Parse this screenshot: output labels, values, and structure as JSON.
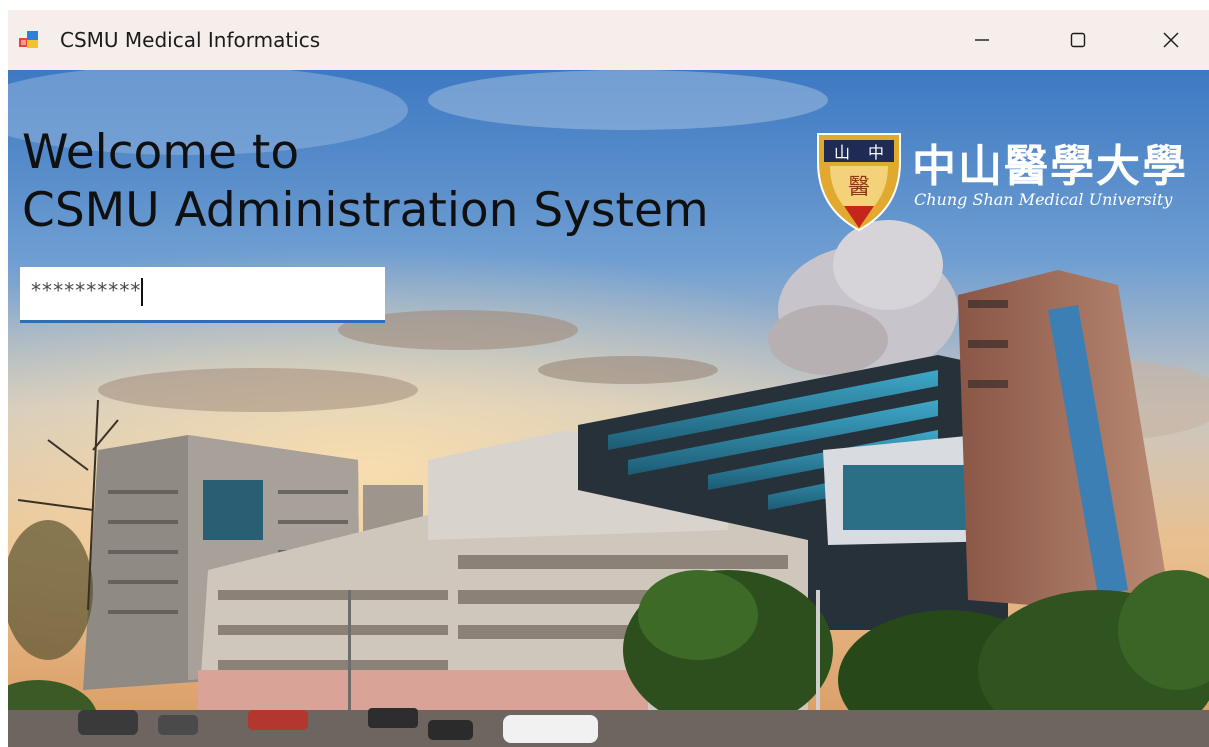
{
  "window": {
    "title": "CSMU Medical Informatics",
    "app_icon": "windows-forms-app-icon",
    "controls": {
      "minimize_icon": "minimize-icon",
      "maximize_icon": "maximize-icon",
      "close_icon": "close-icon"
    }
  },
  "main": {
    "welcome_line1": "Welcome to",
    "welcome_line2": "CSMU Administration System",
    "password": {
      "value": "**********"
    },
    "logo": {
      "chinese_name": "中山醫學大學",
      "english_name": "Chung Shan Medical University",
      "emblem_text_top_left": "山",
      "emblem_text_top_right": "中",
      "emblem_text_center": "醫"
    },
    "background": "campus-photo"
  },
  "colors": {
    "titlebar": "#f6eeeb",
    "accent": "#2d6fb7",
    "emblem_gold": "#e1a92e",
    "emblem_red": "#c4261d",
    "emblem_navy": "#1f2b55"
  }
}
